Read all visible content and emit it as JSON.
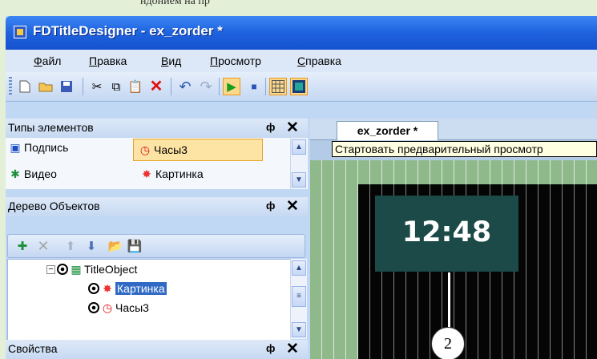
{
  "window": {
    "title": "FDTitleDesigner - ex_zorder *"
  },
  "caption_fragment": "ндонием на пр",
  "menu": [
    "Файл",
    "Правка",
    "Вид",
    "Просмотр",
    "Справка"
  ],
  "panels": {
    "types": {
      "title": "Типы элементов",
      "items": [
        {
          "label": "Подпись",
          "icon": "label-icon"
        },
        {
          "label": "Часы3",
          "icon": "clock-icon",
          "selected": true
        },
        {
          "label": "Видео",
          "icon": "video-icon"
        },
        {
          "label": "Картинка",
          "icon": "picture-icon"
        }
      ]
    },
    "tree": {
      "title": "Дерево Объектов",
      "nodes": [
        {
          "label": "TitleObject",
          "icon": "title-object-icon",
          "level": 0,
          "expanded": true
        },
        {
          "label": "Картинка",
          "icon": "picture-icon",
          "level": 1,
          "selected": true
        },
        {
          "label": "Часы3",
          "icon": "clock-icon",
          "level": 1
        }
      ]
    },
    "properties": {
      "title": "Свойства"
    }
  },
  "pin_label": "ф",
  "close_label": "✕",
  "editor": {
    "tab": "ex_zorder *",
    "tooltip": "Стартовать предварительный просмотр",
    "clock_text": "12:48",
    "callout": "2"
  }
}
